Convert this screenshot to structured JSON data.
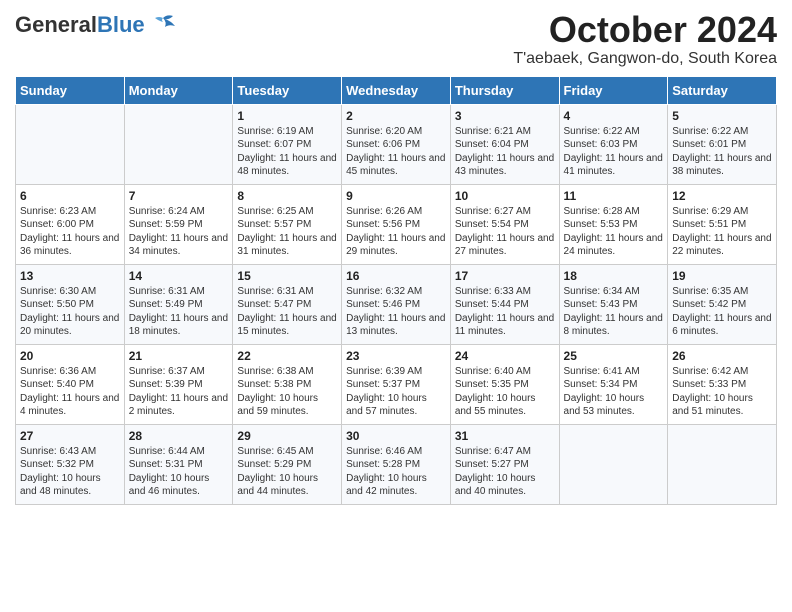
{
  "header": {
    "logo_general": "General",
    "logo_blue": "Blue",
    "title": "October 2024",
    "subtitle": "T'aebaek, Gangwon-do, South Korea"
  },
  "days_of_week": [
    "Sunday",
    "Monday",
    "Tuesday",
    "Wednesday",
    "Thursday",
    "Friday",
    "Saturday"
  ],
  "weeks": [
    [
      {
        "day": "",
        "info": ""
      },
      {
        "day": "",
        "info": ""
      },
      {
        "day": "1",
        "info": "Sunrise: 6:19 AM\nSunset: 6:07 PM\nDaylight: 11 hours and 48 minutes."
      },
      {
        "day": "2",
        "info": "Sunrise: 6:20 AM\nSunset: 6:06 PM\nDaylight: 11 hours and 45 minutes."
      },
      {
        "day": "3",
        "info": "Sunrise: 6:21 AM\nSunset: 6:04 PM\nDaylight: 11 hours and 43 minutes."
      },
      {
        "day": "4",
        "info": "Sunrise: 6:22 AM\nSunset: 6:03 PM\nDaylight: 11 hours and 41 minutes."
      },
      {
        "day": "5",
        "info": "Sunrise: 6:22 AM\nSunset: 6:01 PM\nDaylight: 11 hours and 38 minutes."
      }
    ],
    [
      {
        "day": "6",
        "info": "Sunrise: 6:23 AM\nSunset: 6:00 PM\nDaylight: 11 hours and 36 minutes."
      },
      {
        "day": "7",
        "info": "Sunrise: 6:24 AM\nSunset: 5:59 PM\nDaylight: 11 hours and 34 minutes."
      },
      {
        "day": "8",
        "info": "Sunrise: 6:25 AM\nSunset: 5:57 PM\nDaylight: 11 hours and 31 minutes."
      },
      {
        "day": "9",
        "info": "Sunrise: 6:26 AM\nSunset: 5:56 PM\nDaylight: 11 hours and 29 minutes."
      },
      {
        "day": "10",
        "info": "Sunrise: 6:27 AM\nSunset: 5:54 PM\nDaylight: 11 hours and 27 minutes."
      },
      {
        "day": "11",
        "info": "Sunrise: 6:28 AM\nSunset: 5:53 PM\nDaylight: 11 hours and 24 minutes."
      },
      {
        "day": "12",
        "info": "Sunrise: 6:29 AM\nSunset: 5:51 PM\nDaylight: 11 hours and 22 minutes."
      }
    ],
    [
      {
        "day": "13",
        "info": "Sunrise: 6:30 AM\nSunset: 5:50 PM\nDaylight: 11 hours and 20 minutes."
      },
      {
        "day": "14",
        "info": "Sunrise: 6:31 AM\nSunset: 5:49 PM\nDaylight: 11 hours and 18 minutes."
      },
      {
        "day": "15",
        "info": "Sunrise: 6:31 AM\nSunset: 5:47 PM\nDaylight: 11 hours and 15 minutes."
      },
      {
        "day": "16",
        "info": "Sunrise: 6:32 AM\nSunset: 5:46 PM\nDaylight: 11 hours and 13 minutes."
      },
      {
        "day": "17",
        "info": "Sunrise: 6:33 AM\nSunset: 5:44 PM\nDaylight: 11 hours and 11 minutes."
      },
      {
        "day": "18",
        "info": "Sunrise: 6:34 AM\nSunset: 5:43 PM\nDaylight: 11 hours and 8 minutes."
      },
      {
        "day": "19",
        "info": "Sunrise: 6:35 AM\nSunset: 5:42 PM\nDaylight: 11 hours and 6 minutes."
      }
    ],
    [
      {
        "day": "20",
        "info": "Sunrise: 6:36 AM\nSunset: 5:40 PM\nDaylight: 11 hours and 4 minutes."
      },
      {
        "day": "21",
        "info": "Sunrise: 6:37 AM\nSunset: 5:39 PM\nDaylight: 11 hours and 2 minutes."
      },
      {
        "day": "22",
        "info": "Sunrise: 6:38 AM\nSunset: 5:38 PM\nDaylight: 10 hours and 59 minutes."
      },
      {
        "day": "23",
        "info": "Sunrise: 6:39 AM\nSunset: 5:37 PM\nDaylight: 10 hours and 57 minutes."
      },
      {
        "day": "24",
        "info": "Sunrise: 6:40 AM\nSunset: 5:35 PM\nDaylight: 10 hours and 55 minutes."
      },
      {
        "day": "25",
        "info": "Sunrise: 6:41 AM\nSunset: 5:34 PM\nDaylight: 10 hours and 53 minutes."
      },
      {
        "day": "26",
        "info": "Sunrise: 6:42 AM\nSunset: 5:33 PM\nDaylight: 10 hours and 51 minutes."
      }
    ],
    [
      {
        "day": "27",
        "info": "Sunrise: 6:43 AM\nSunset: 5:32 PM\nDaylight: 10 hours and 48 minutes."
      },
      {
        "day": "28",
        "info": "Sunrise: 6:44 AM\nSunset: 5:31 PM\nDaylight: 10 hours and 46 minutes."
      },
      {
        "day": "29",
        "info": "Sunrise: 6:45 AM\nSunset: 5:29 PM\nDaylight: 10 hours and 44 minutes."
      },
      {
        "day": "30",
        "info": "Sunrise: 6:46 AM\nSunset: 5:28 PM\nDaylight: 10 hours and 42 minutes."
      },
      {
        "day": "31",
        "info": "Sunrise: 6:47 AM\nSunset: 5:27 PM\nDaylight: 10 hours and 40 minutes."
      },
      {
        "day": "",
        "info": ""
      },
      {
        "day": "",
        "info": ""
      }
    ]
  ]
}
